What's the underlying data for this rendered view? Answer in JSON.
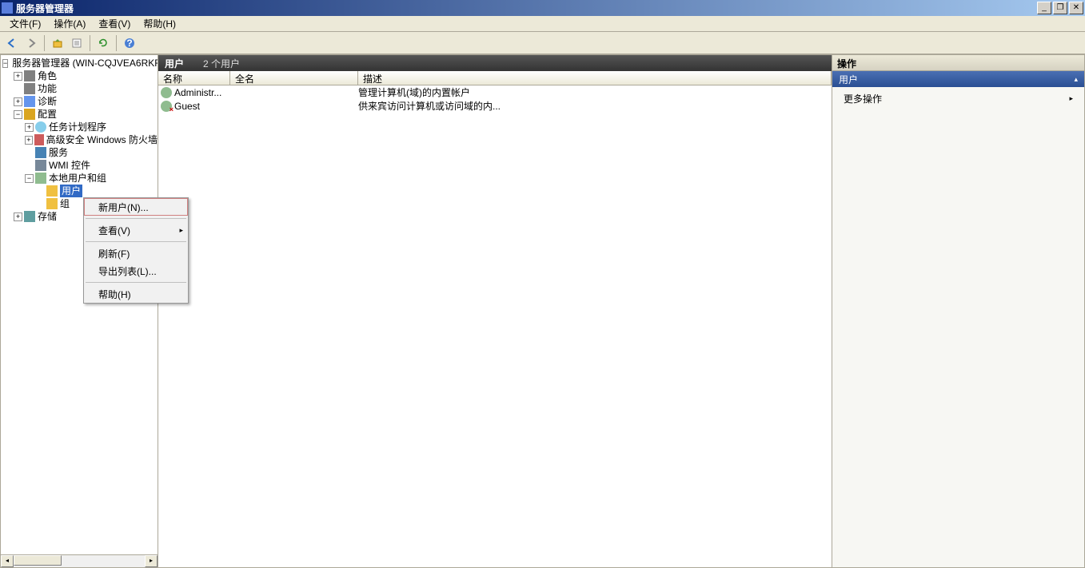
{
  "window": {
    "title": "服务器管理器"
  },
  "menubar": {
    "file": "文件(F)",
    "action": "操作(A)",
    "view": "查看(V)",
    "help": "帮助(H)"
  },
  "tree": {
    "root": "服务器管理器 (WIN-CQJVEA6RKR",
    "roles": "角色",
    "features": "功能",
    "diagnostics": "诊断",
    "config": "配置",
    "task_scheduler": "任务计划程序",
    "firewall": "高级安全 Windows 防火墙",
    "services": "服务",
    "wmi": "WMI 控件",
    "local_users_groups": "本地用户和组",
    "users": "用户",
    "groups": "组",
    "storage": "存储"
  },
  "list": {
    "title": "用户",
    "count": "2 个用户",
    "columns": {
      "name": "名称",
      "fullname": "全名",
      "description": "描述"
    },
    "rows": [
      {
        "name": "Administr...",
        "fullname": "",
        "description": "管理计算机(域)的内置帐户"
      },
      {
        "name": "Guest",
        "fullname": "",
        "description": "供来宾访问计算机或访问域的内..."
      }
    ]
  },
  "context_menu": {
    "new_user": "新用户(N)...",
    "view": "查看(V)",
    "refresh": "刷新(F)",
    "export_list": "导出列表(L)...",
    "help": "帮助(H)"
  },
  "actions": {
    "heading": "操作",
    "subheading": "用户",
    "more": "更多操作"
  }
}
